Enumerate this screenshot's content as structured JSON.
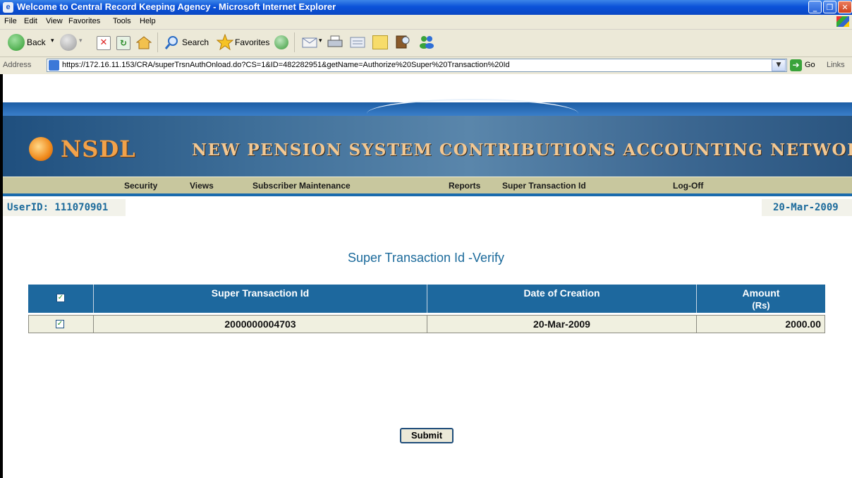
{
  "window": {
    "title": "Welcome to Central Record Keeping Agency - Microsoft Internet Explorer",
    "app_icon": "ie-icon",
    "minimize_glyph": "_",
    "maximize_glyph": "❐",
    "close_glyph": "✕"
  },
  "menu": [
    "File",
    "Edit",
    "View",
    "Favorites",
    "Tools",
    "Help"
  ],
  "toolbar": {
    "back_label": "Back",
    "search_label": "Search",
    "favorites_label": "Favorites"
  },
  "address": {
    "label": "Address",
    "url": "https://172.16.11.153/CRA/superTrsnAuthOnload.do?CS=1&ID=482282951&getName=Authorize%20Super%20Transaction%20Id",
    "go_label": "Go",
    "links_label": "Links"
  },
  "banner": {
    "logo": "NSDL",
    "title": "NEW PENSION SYSTEM CONTRIBUTIONS ACCOUNTING NETWORK"
  },
  "nav": [
    "Security",
    "Views",
    "Subscriber Maintenance",
    "Reports",
    "Super Transaction Id",
    "Log-Off"
  ],
  "user": {
    "id_text": "UserID: 111070901",
    "date": "20-Mar-2009"
  },
  "page_heading": "Super Transaction Id -Verify",
  "table": {
    "headers": {
      "select": "",
      "super_txn_id": "Super Transaction Id",
      "date_of_creation": "Date of Creation",
      "amount": "Amount",
      "amount_unit": "(Rs)"
    },
    "rows": [
      {
        "checked": true,
        "super_txn_id": "2000000004703",
        "date_of_creation": "20-Mar-2009",
        "amount": "2000.00"
      }
    ],
    "header_checked": true
  },
  "submit_label": "Submit",
  "colors": {
    "table_header": "#1d689e",
    "heading_text": "#1b6a9b",
    "nav_bar": "#c8c79e"
  }
}
